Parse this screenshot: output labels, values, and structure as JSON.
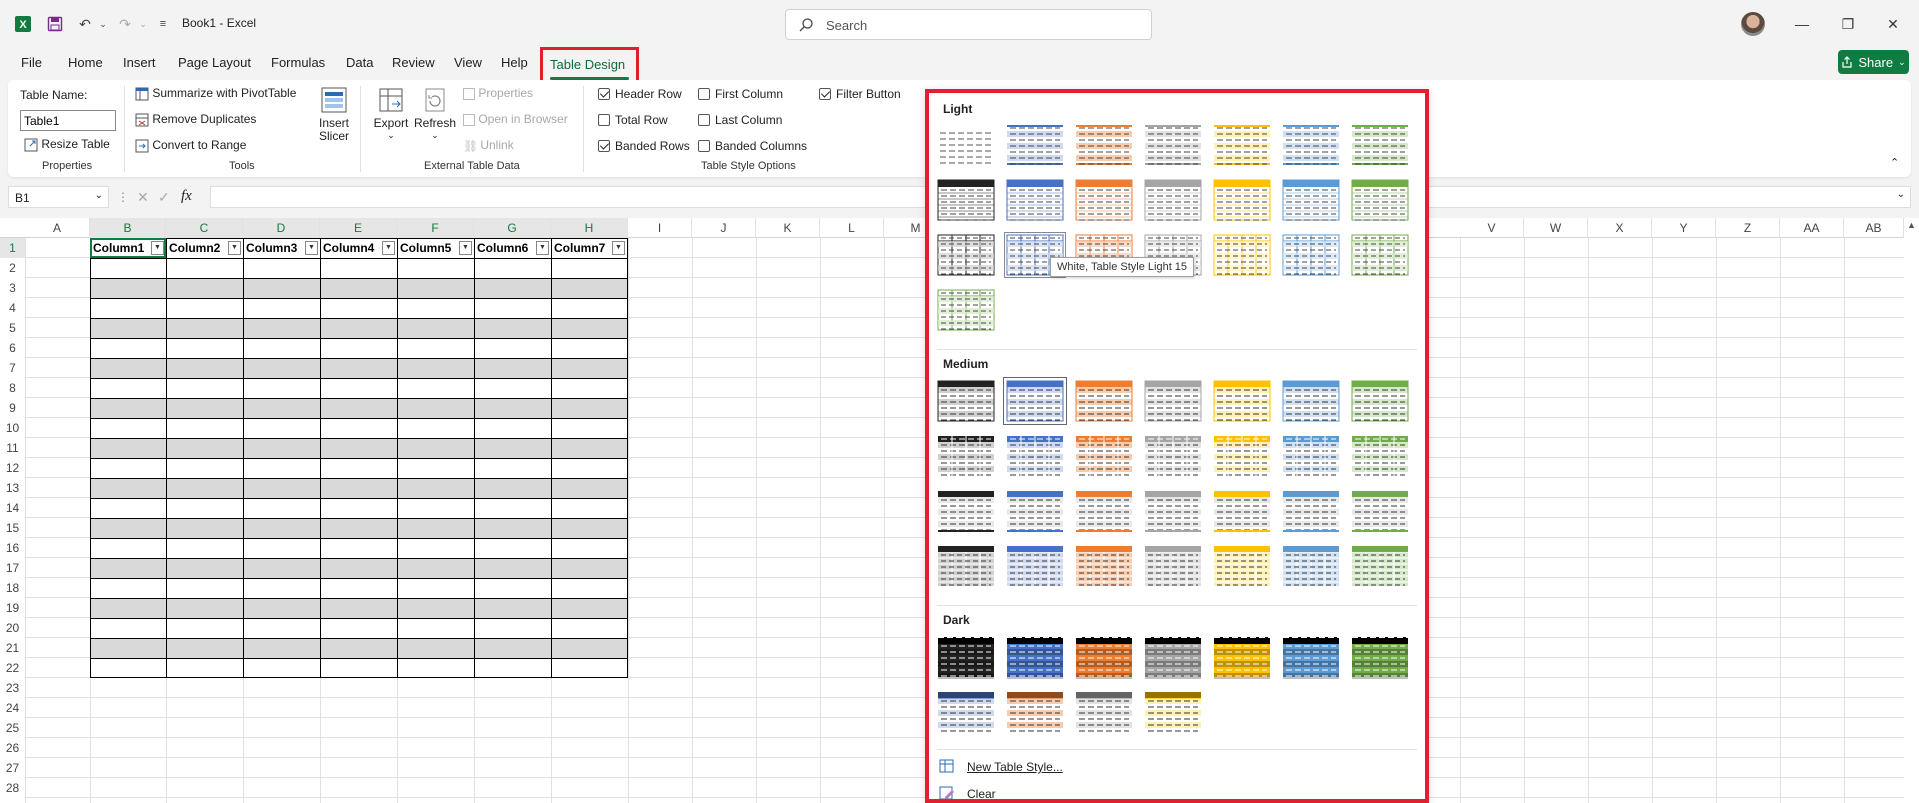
{
  "app": {
    "title": "Book1  -  Excel",
    "search_placeholder": "Search"
  },
  "menu": [
    "File",
    "Home",
    "Insert",
    "Page Layout",
    "Formulas",
    "Data",
    "Review",
    "View",
    "Help"
  ],
  "active_tab": "Table Design",
  "share_label": "Share",
  "ribbon": {
    "properties": {
      "table_name_label": "Table Name:",
      "table_name_value": "Table1",
      "resize_label": "Resize Table",
      "group": "Properties"
    },
    "tools": {
      "pivot": "Summarize with PivotTable",
      "dupes": "Remove Duplicates",
      "convert": "Convert to Range",
      "slicer_line1": "Insert",
      "slicer_line2": "Slicer",
      "group": "Tools"
    },
    "external": {
      "export": "Export",
      "refresh": "Refresh",
      "properties": "Properties",
      "open_browser": "Open in Browser",
      "unlink": "Unlink",
      "group": "External Table Data"
    },
    "style_options": {
      "header_row": "Header Row",
      "total_row": "Total Row",
      "banded_rows": "Banded Rows",
      "first_column": "First Column",
      "last_column": "Last Column",
      "banded_columns": "Banded Columns",
      "filter_button": "Filter Button",
      "group": "Table Style Options",
      "states": {
        "header_row": true,
        "total_row": false,
        "banded_rows": true,
        "first_column": false,
        "last_column": false,
        "banded_columns": false,
        "filter_button": true
      }
    }
  },
  "formula_bar": {
    "name_box": "B1",
    "fx": "fx",
    "value": ""
  },
  "columns": [
    "A",
    "B",
    "C",
    "D",
    "E",
    "F",
    "G",
    "H",
    "I",
    "J",
    "K",
    "L",
    "M",
    "V",
    "W",
    "X",
    "Y",
    "Z",
    "AA",
    "AB"
  ],
  "rows": [
    "1",
    "2",
    "3",
    "4",
    "5",
    "6",
    "7",
    "8",
    "9",
    "10",
    "11",
    "12",
    "13",
    "14",
    "15",
    "16",
    "17",
    "18",
    "19",
    "20",
    "21",
    "22",
    "23",
    "24",
    "25",
    "26",
    "27",
    "28"
  ],
  "table_headers": [
    "Column1",
    "Column2",
    "Column3",
    "Column4",
    "Column5",
    "Column6",
    "Column7"
  ],
  "gallery": {
    "light_label": "Light",
    "medium_label": "Medium",
    "dark_label": "Dark",
    "tooltip": "White, Table Style Light 15",
    "new_style": "New Table Style...",
    "clear": "Clear",
    "colors": {
      "black": "#222222",
      "blue": "#4472c4",
      "orange": "#ed7d31",
      "gray": "#a5a5a5",
      "gold": "#ffc000",
      "lightblue": "#5b9bd5",
      "green": "#70ad47"
    }
  }
}
